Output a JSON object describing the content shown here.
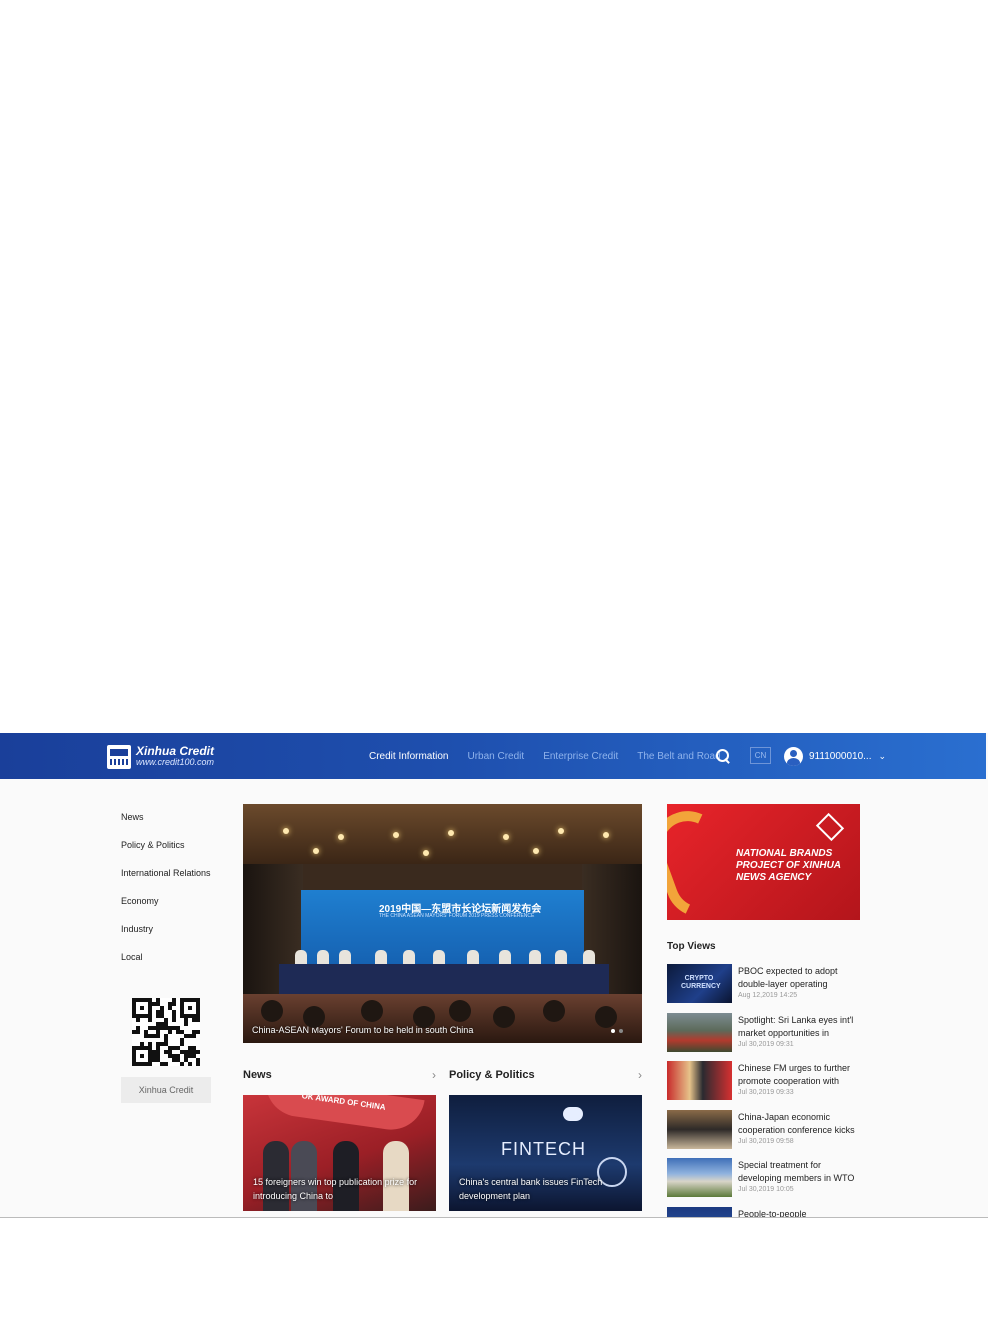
{
  "brand": {
    "name": "Xinhua Credit",
    "url": "www.credit100.com"
  },
  "nav": {
    "items": [
      "Credit Information",
      "Urban Credit",
      "Enterprise Credit",
      "The Belt and Road"
    ],
    "lang": "CN",
    "user_id": "9111000010..."
  },
  "sidebar": {
    "items": [
      "News",
      "Policy & Politics",
      "International Relations",
      "Economy",
      "Industry",
      "Local"
    ],
    "qr_label": "Xinhua Credit"
  },
  "hero": {
    "caption": "China-ASEAN Mayors' Forum to be held in south China",
    "screen_title": "2019中国—东盟市长论坛新闻发布会",
    "screen_subtitle": "THE CHINA ASEAN MAYORS' FORUM 2019 PRESS CONFERENCE",
    "slide_count": 2,
    "active_slide": 1
  },
  "sections": {
    "news": {
      "title": "News",
      "card_caption": "15 foreigners win top publication prize for introducing China to",
      "banner_text": "OK AWARD OF CHINA"
    },
    "policy": {
      "title": "Policy & Politics",
      "card_caption": "China's central bank issues FinTech development plan",
      "image_word": "FINTECH"
    }
  },
  "ad": {
    "text": "NATIONAL BRANDS PROJECT OF XINHUA NEWS AGENCY"
  },
  "top_views": {
    "title": "Top Views",
    "items": [
      {
        "title": "PBOC expected to adopt double-layer operating",
        "date": "Aug 12,2019 14:25",
        "thumb_word": "CRYPTO CURRENCY"
      },
      {
        "title": "Spotlight: Sri Lanka eyes int'l market opportunities in",
        "date": "Jul 30,2019 09:31"
      },
      {
        "title": "Chinese FM urges to further promote cooperation with",
        "date": "Jul 30,2019 09:33"
      },
      {
        "title": "China-Japan economic cooperation conference kicks",
        "date": "Jul 30,2019 09:58"
      },
      {
        "title": "Special treatment for developing members in WTO",
        "date": "Jul 30,2019 10:05"
      },
      {
        "title": "People-to-people",
        "date": ""
      }
    ]
  },
  "colors": {
    "header_start": "#1a3f9a",
    "header_end": "#2a6fd0",
    "ad_red": "#e8242a",
    "nav_inactive": "#8fb3ec"
  }
}
